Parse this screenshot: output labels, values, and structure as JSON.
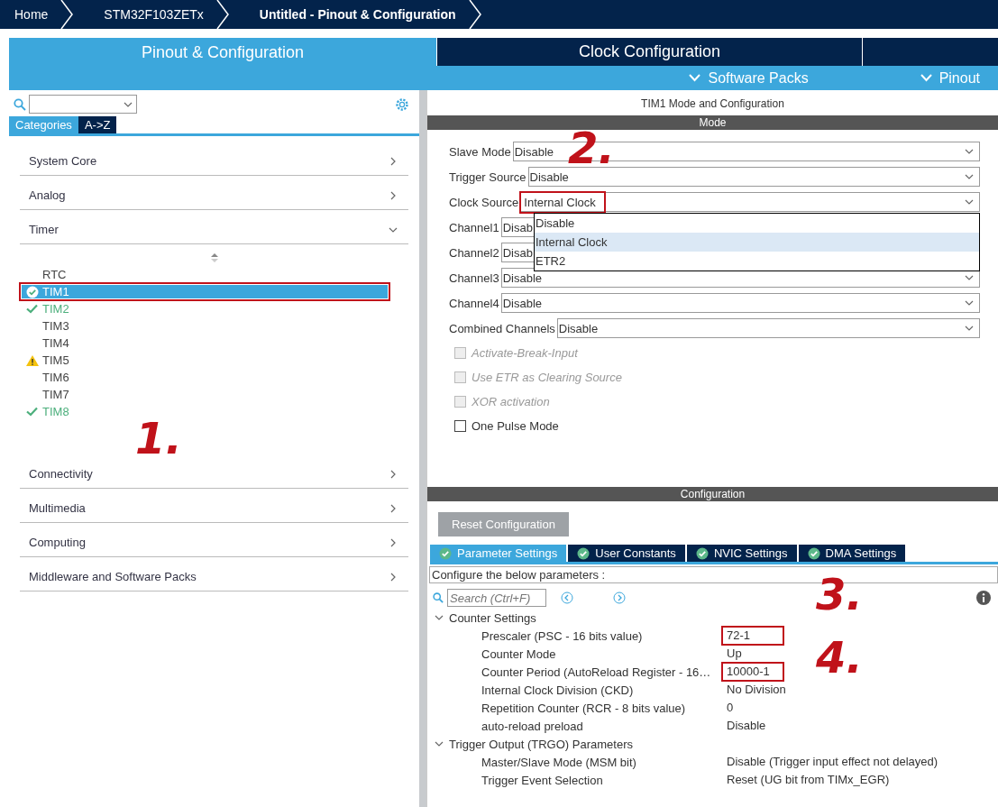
{
  "breadcrumbs": [
    {
      "label": "Home",
      "selected": false
    },
    {
      "label": "STM32F103ZETx",
      "selected": false
    },
    {
      "label": "Untitled - Pinout & Configuration",
      "selected": true
    }
  ],
  "main_tabs": [
    {
      "label": "Pinout & Configuration",
      "selected": true
    },
    {
      "label": "Clock Configuration",
      "selected": false
    }
  ],
  "sub_menu": [
    "Software Packs",
    "Pinout"
  ],
  "sidebar": {
    "view_tabs": [
      {
        "label": "Categories",
        "selected": true
      },
      {
        "label": "A->Z",
        "selected": false
      }
    ],
    "categories": [
      {
        "label": "System Core",
        "expanded": false
      },
      {
        "label": "Analog",
        "expanded": false
      },
      {
        "label": "Timer",
        "expanded": true,
        "children": [
          {
            "label": "RTC",
            "configured": false,
            "warning": false,
            "selected": false,
            "highlighted": false
          },
          {
            "label": "TIM1",
            "configured": true,
            "warning": false,
            "selected": true,
            "highlighted": true
          },
          {
            "label": "TIM2",
            "configured": true,
            "warning": false,
            "selected": false,
            "highlighted": false
          },
          {
            "label": "TIM3",
            "configured": false,
            "warning": false,
            "selected": false,
            "highlighted": false
          },
          {
            "label": "TIM4",
            "configured": false,
            "warning": false,
            "selected": false,
            "highlighted": false
          },
          {
            "label": "TIM5",
            "configured": false,
            "warning": true,
            "selected": false,
            "highlighted": false
          },
          {
            "label": "TIM6",
            "configured": false,
            "warning": false,
            "selected": false,
            "highlighted": false
          },
          {
            "label": "TIM7",
            "configured": false,
            "warning": false,
            "selected": false,
            "highlighted": false
          },
          {
            "label": "TIM8",
            "configured": true,
            "warning": false,
            "selected": false,
            "highlighted": false
          }
        ]
      },
      {
        "label": "Connectivity",
        "expanded": false
      },
      {
        "label": "Multimedia",
        "expanded": false
      },
      {
        "label": "Computing",
        "expanded": false
      },
      {
        "label": "Middleware and Software Packs",
        "expanded": false
      }
    ]
  },
  "panel": {
    "title": "TIM1 Mode and Configuration",
    "mode_header": "Mode",
    "mode_fields": [
      {
        "label": "Slave Mode",
        "value": "Disable",
        "highlighted": false
      },
      {
        "label": "Trigger Source",
        "value": "Disable",
        "highlighted": false
      },
      {
        "label": "Clock Source",
        "value": "Internal Clock",
        "highlighted": true,
        "dropdown": {
          "options": [
            {
              "label": "Disable",
              "selected": false
            },
            {
              "label": "Internal Clock",
              "selected": true
            },
            {
              "label": "ETR2",
              "selected": false
            }
          ]
        }
      },
      {
        "label": "Channel1",
        "value": "Disab",
        "highlighted": false
      },
      {
        "label": "Channel2",
        "value": "Disab",
        "highlighted": false
      },
      {
        "label": "Channel3",
        "value": "Disable",
        "highlighted": false
      },
      {
        "label": "Channel4",
        "value": "Disable",
        "highlighted": false
      },
      {
        "label": "Combined Channels",
        "value": "Disable",
        "highlighted": false
      }
    ],
    "checkboxes": [
      {
        "label": "Activate-Break-Input",
        "checked": false,
        "disabled": true
      },
      {
        "label": "Use ETR as Clearing Source",
        "checked": false,
        "disabled": true
      },
      {
        "label": "XOR activation",
        "checked": false,
        "disabled": true
      },
      {
        "label": "One Pulse Mode",
        "checked": false,
        "disabled": false
      }
    ],
    "config_header": "Configuration",
    "reset_button": "Reset Configuration",
    "config_tabs": [
      {
        "label": "Parameter Settings",
        "selected": true
      },
      {
        "label": "User Constants",
        "selected": false
      },
      {
        "label": "NVIC Settings",
        "selected": false
      },
      {
        "label": "DMA Settings",
        "selected": false
      }
    ],
    "description": "Configure the below parameters :",
    "search_placeholder": "Search (Ctrl+F)",
    "groups": [
      {
        "label": "Counter Settings",
        "expanded": true,
        "params": [
          {
            "name": "Prescaler (PSC - 16 bits value)",
            "value": "72-1",
            "highlighted": true
          },
          {
            "name": "Counter Mode",
            "value": "Up",
            "highlighted": false
          },
          {
            "name": "Counter Period (AutoReload Register - 16…",
            "value": "10000-1",
            "highlighted": true
          },
          {
            "name": "Internal Clock Division (CKD)",
            "value": "No Division",
            "highlighted": false
          },
          {
            "name": "Repetition Counter (RCR - 8 bits value)",
            "value": "0",
            "highlighted": false
          },
          {
            "name": "auto-reload preload",
            "value": "Disable",
            "highlighted": false
          }
        ]
      },
      {
        "label": "Trigger Output (TRGO) Parameters",
        "expanded": true,
        "params": [
          {
            "name": "Master/Slave Mode (MSM bit)",
            "value": "Disable (Trigger input effect not delayed)",
            "highlighted": false
          },
          {
            "name": "Trigger Event Selection",
            "value": "Reset (UG bit from TIMx_EGR)",
            "highlighted": false
          }
        ]
      }
    ]
  },
  "annotations": [
    {
      "label": "1."
    },
    {
      "label": "2."
    },
    {
      "label": "3."
    },
    {
      "label": "4."
    }
  ]
}
